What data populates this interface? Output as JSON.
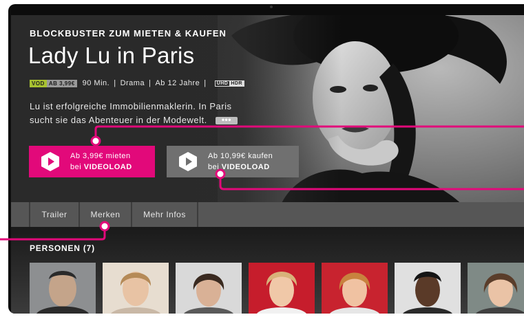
{
  "hero": {
    "section_label": "BLOCKBUSTER ZUM MIETEN & KAUFEN",
    "title": "Lady Lu in Paris",
    "badge_vod": "VOD",
    "badge_price": "AB 3,99€",
    "meta": [
      "90 Min.",
      "|",
      "Drama",
      "|",
      "Ab 12 Jahre",
      "|"
    ],
    "uhd_label": "UHD",
    "hdr_label": "HDR",
    "description_line1": "Lu ist erfolgreiche Immobilienmaklerin. In Paris",
    "description_line2": "sucht sie das Abenteuer in der Modewelt.",
    "more_label": "•••"
  },
  "buttons": {
    "rent_line1": "Ab 3,99€ mieten",
    "rent_line2_prefix": "bei ",
    "rent_line2_bold": "VIDEOLOAD",
    "buy_line1": "Ab 10,99€ kaufen",
    "buy_line2_prefix": "bei ",
    "buy_line2_bold": "VIDEOLOAD"
  },
  "tabs": [
    {
      "label": "Trailer"
    },
    {
      "label": "Merken"
    },
    {
      "label": "Mehr Infos"
    }
  ],
  "persons": {
    "heading": "PERSONEN (7)",
    "count": 7
  },
  "colors": {
    "accent": "#e2097a",
    "vod_badge": "#a8c230",
    "background": "#2d2d2d"
  }
}
